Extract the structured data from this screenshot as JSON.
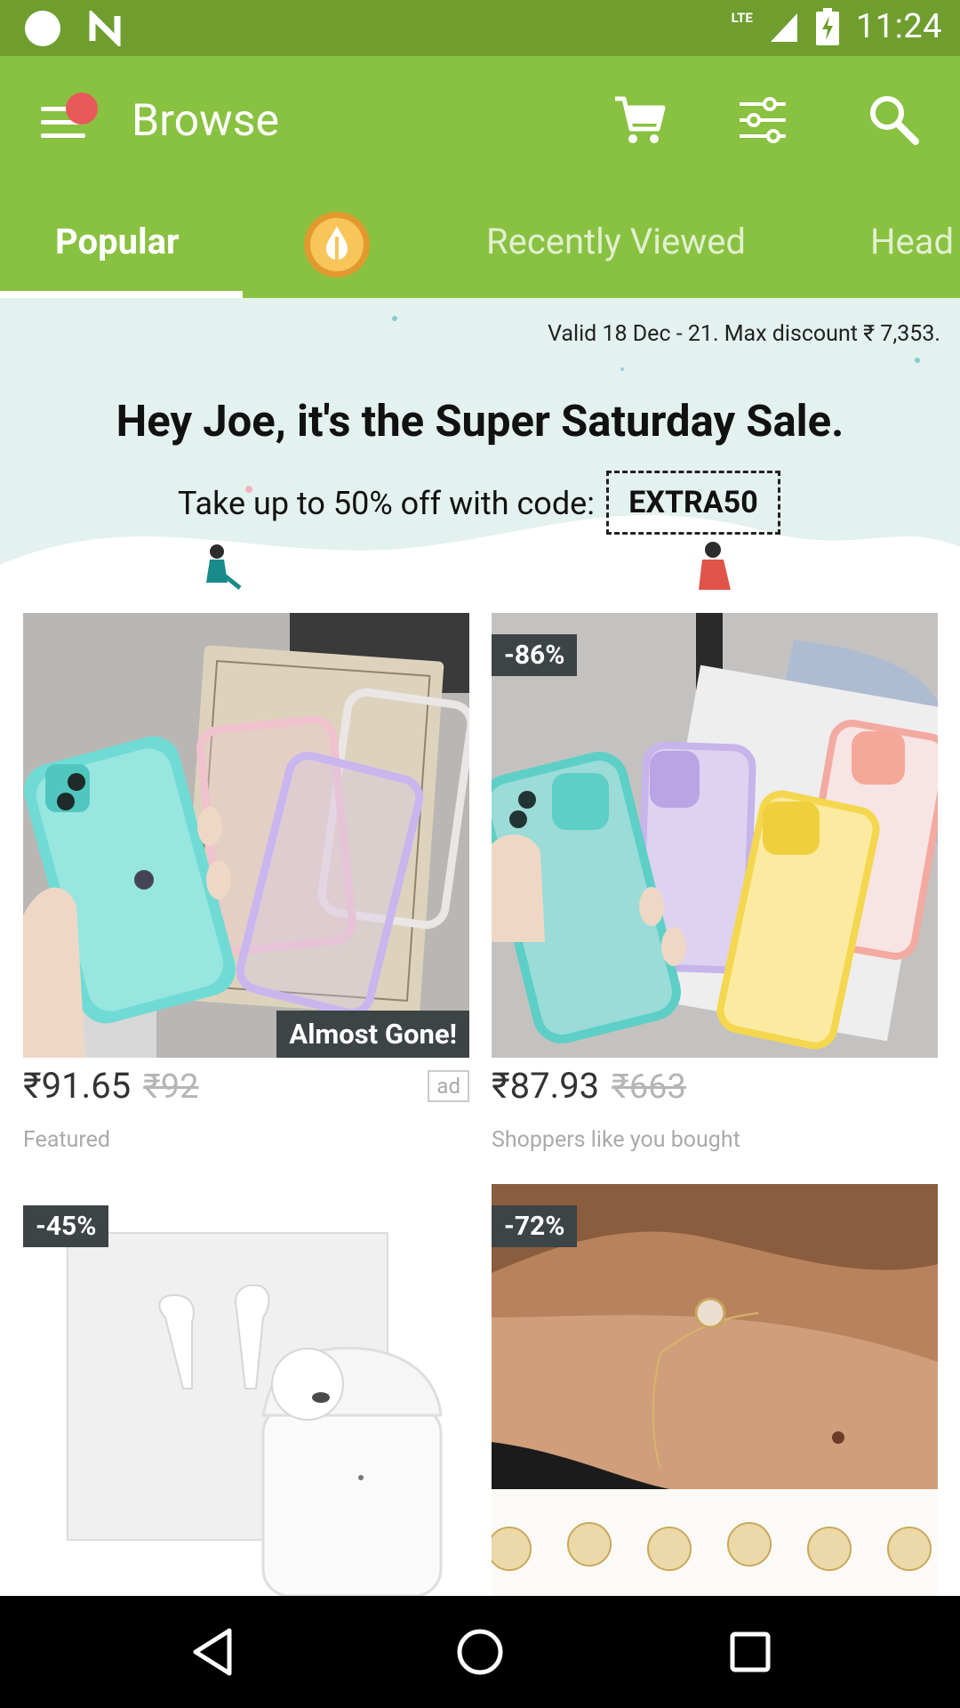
{
  "status_bar": {
    "network": "LTE",
    "time": "11:24"
  },
  "app_bar": {
    "title": "Browse",
    "icons": [
      "menu-icon",
      "cart-icon",
      "filter-icon",
      "search-icon"
    ]
  },
  "tabs": [
    {
      "label": "Popular",
      "active": true
    },
    {
      "label": "",
      "icon": "coin-icon"
    },
    {
      "label": "Recently Viewed",
      "active": false
    },
    {
      "label": "Head",
      "active": false
    }
  ],
  "banner": {
    "validity": "Valid 18 Dec - 21. Max discount ₹ 7,353.",
    "headline": "Hey Joe, it's the Super Saturday Sale.",
    "subline": "Take up to 50% off with code:",
    "code": "EXTRA50"
  },
  "products": [
    {
      "image": "phone-cases-glitter-image",
      "badge": "Almost Gone!",
      "price": "₹91.65",
      "original_price": "₹92",
      "ad_label": "ad",
      "caption": "Featured"
    },
    {
      "image": "phone-cases-slide-camera-image",
      "discount": "-86%",
      "price": "₹87.93",
      "original_price": "₹663",
      "caption": "Shoppers like you bought"
    },
    {
      "image": "earbuds-image",
      "discount": "-45%"
    },
    {
      "image": "initial-bracelet-image",
      "discount": "-72%"
    }
  ],
  "colors": {
    "status_bar": "#6f9e2f",
    "app_bar": "#89c140",
    "banner_bg": "#e3f1ef",
    "badge_bg": "#3d4446",
    "notification": "#e85a5a"
  }
}
